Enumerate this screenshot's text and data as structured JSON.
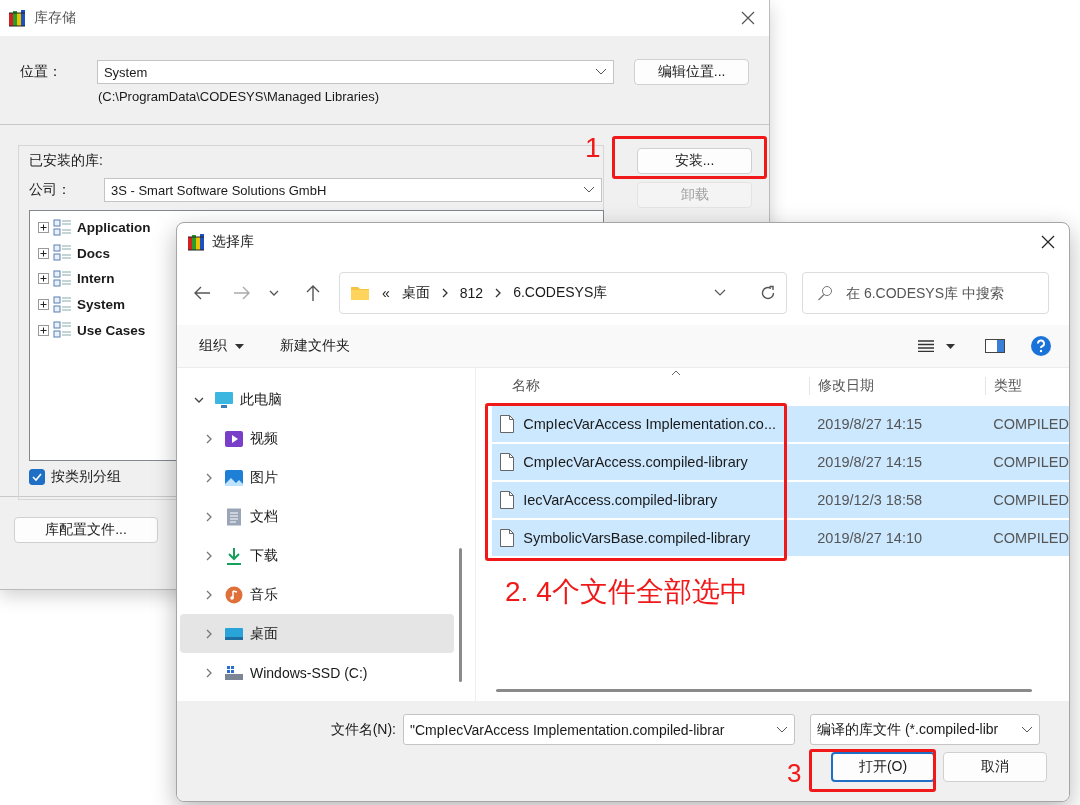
{
  "repository_dialog": {
    "title": "库存储",
    "location": {
      "label": "位置：",
      "value": "System",
      "path": "(C:\\ProgramData\\CODESYS\\Managed Libraries)"
    },
    "edit_location_button": "编辑位置...",
    "installed_libraries": {
      "label": "已安装的库:",
      "company_label": "公司：",
      "company_value": "3S - Smart Software Solutions GmbH",
      "tree": [
        {
          "label": "Application",
          "expanded": false
        },
        {
          "label": "Docs",
          "expanded": false
        },
        {
          "label": "Intern",
          "expanded": false
        },
        {
          "label": "System",
          "expanded": false
        },
        {
          "label": "Use Cases",
          "expanded": false
        }
      ],
      "group_by_category": {
        "label": "按类别分组",
        "checked": true
      }
    },
    "buttons": [
      {
        "label": "安装...",
        "disabled": false
      },
      {
        "label": "卸载",
        "disabled": true
      }
    ],
    "profile_button": "库配置文件..."
  },
  "file_dialog": {
    "title": "选择库",
    "breadcrumb": {
      "overflow": "«",
      "items": [
        "桌面",
        "812",
        "6.CODESYS库"
      ]
    },
    "search": {
      "placeholder": "在 6.CODESYS库 中搜索"
    },
    "toolbar": {
      "organize": "组织",
      "new_folder": "新建文件夹"
    },
    "nav_pane": [
      {
        "label": "此电脑",
        "kind": "pc",
        "expanded": true,
        "selected": false,
        "children": [
          {
            "label": "视频",
            "kind": "video",
            "expanded": false,
            "selected": false
          },
          {
            "label": "图片",
            "kind": "pictures",
            "expanded": false,
            "selected": false
          },
          {
            "label": "文档",
            "kind": "documents",
            "expanded": false,
            "selected": false
          },
          {
            "label": "下载",
            "kind": "downloads",
            "expanded": false,
            "selected": false
          },
          {
            "label": "音乐",
            "kind": "music",
            "expanded": false,
            "selected": false
          },
          {
            "label": "桌面",
            "kind": "desktop",
            "expanded": false,
            "selected": true
          },
          {
            "label": "Windows-SSD (C:)",
            "kind": "drive",
            "expanded": false,
            "selected": false
          }
        ]
      }
    ],
    "columns": [
      "名称",
      "修改日期",
      "类型"
    ],
    "files": [
      {
        "name": "CmpIecVarAccess Implementation.co...",
        "date": "2019/8/27 14:15",
        "type": "COMPILED",
        "selected": true
      },
      {
        "name": "CmpIecVarAccess.compiled-library",
        "date": "2019/8/27 14:15",
        "type": "COMPILED",
        "selected": true
      },
      {
        "name": "IecVarAccess.compiled-library",
        "date": "2019/12/3 18:58",
        "type": "COMPILED",
        "selected": true
      },
      {
        "name": "SymbolicVarsBase.compiled-library",
        "date": "2019/8/27 14:10",
        "type": "COMPILED",
        "selected": true
      }
    ],
    "file_name": {
      "label": "文件名(N):",
      "value": "\"CmpIecVarAccess Implementation.compiled-librar"
    },
    "file_type": "编译的库文件 (*.compiled-libr",
    "buttons": [
      "打开(O)",
      "取消"
    ]
  },
  "annotations": [
    "1",
    "2. 4个文件全部选中",
    "3"
  ]
}
